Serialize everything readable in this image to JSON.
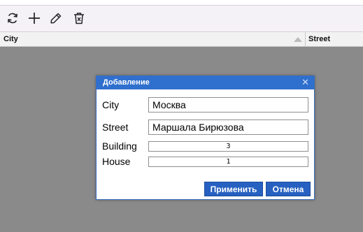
{
  "toolbar": {
    "buttons": [
      {
        "icon": "refresh-icon"
      },
      {
        "icon": "plus-icon"
      },
      {
        "icon": "pencil-icon"
      },
      {
        "icon": "trash-icon"
      }
    ]
  },
  "grid": {
    "columns": [
      "City",
      "Street"
    ],
    "sorted_column": "City",
    "sort_direction": "ascending"
  },
  "dialog": {
    "title": "Добавление",
    "close_icon": "close-icon",
    "fields": {
      "city": {
        "label": "City",
        "value": "Москва"
      },
      "street": {
        "label": "Street",
        "value": "Маршала Бирюзова"
      },
      "building": {
        "label": "Building",
        "value": "3"
      },
      "house": {
        "label": "House",
        "value": "1"
      }
    },
    "apply_label": "Применить",
    "cancel_label": "Отмена"
  },
  "colors": {
    "dialog_header": "#2f6fcd",
    "button_bg": "#2660c0",
    "overlay": "#8a8a8a",
    "toolbar_bg": "#f4f1f7"
  }
}
